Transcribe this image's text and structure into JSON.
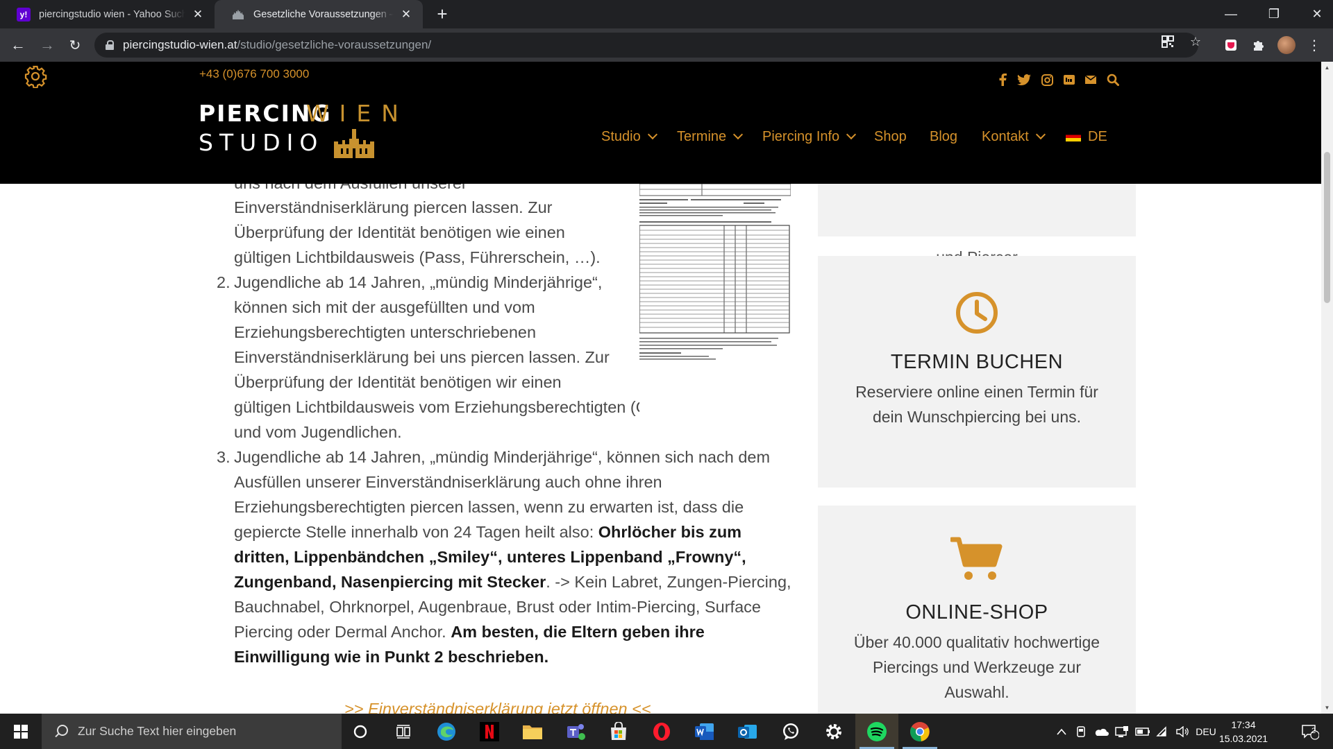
{
  "browser": {
    "tabs": [
      {
        "title": "piercingstudio wien - Yahoo Suche",
        "favicon": "yahoo-icon"
      },
      {
        "title": "Gesetzliche Voraussetzungen – Piercing Studio Wien",
        "favicon": "castle-icon"
      }
    ],
    "url_host": "piercingstudio-wien.at",
    "url_path": "/studio/gesetzliche-voraussetzungen/"
  },
  "site": {
    "phone": "+43 (0)676 700 3000",
    "logo": {
      "line1": "PIERCING",
      "line2": "STUDIO",
      "wien": "WIEN"
    },
    "nav": [
      "Studio",
      "Termine",
      "Piercing Info",
      "Shop",
      "Blog",
      "Kontakt",
      "DE"
    ],
    "accent": "#d6922b"
  },
  "content": {
    "cut_line": "uns nach dem Ausfüllen unserer",
    "item1_tail": [
      "Einverständniserklärung piercen lassen. Zur",
      "Überprüfung der Identität benötigen wie einen",
      "gültigen Lichtbildausweis (Pass, Führerschein, …)."
    ],
    "item2_num": "2.",
    "item2_lines": [
      "Jugendliche ab 14 Jahren, „mündig Minderjährige“,",
      "können sich mit der ausgefüllten und vom",
      "Erziehungsberechtigten unterschriebenen",
      "Einverständniserklärung bei uns piercen lassen. Zur",
      "Überprüfung der Identität benötigen wir einen",
      "gültigen Lichtbildausweis vom Erziehungsberechtigten (Original oder Kopie)",
      "und vom Jugendlichen."
    ],
    "item3_num": "3.",
    "item3_lines": [
      "Jugendliche ab 14 Jahren, „mündig Minderjährige“, können sich nach dem",
      "Ausfüllen unserer Einverständniserklärung auch ohne ihren",
      "Erziehungsberechtigten piercen lassen, wenn zu erwarten ist, dass die"
    ],
    "item3_l4_plain": "gepiercte Stelle innerhalb von 24 Tagen heilt also: ",
    "item3_l4_bold": "Ohrlöcher bis zum",
    "item3_l5_bold": "dritten, Lippenbändchen „Smiley“, unteres Lippenband „Frowny“,",
    "item3_l6_bold": "Zungenband, Nasenpiercing mit Stecker",
    "item3_l6_plain": ". -> Kein Labret, Zungen-Piercing,",
    "item3_l7": "Bauchnabel, Ohrknorpel, Augenbraue, Brust oder Intim-Piercing, Surface",
    "item3_l8_plain": "Piercing oder Dermal Anchor. ",
    "item3_l8_bold": "Am besten, die Eltern geben ihre",
    "item3_l9_bold": "Einwilligung wie in Punkt 2 beschrieben.",
    "link": ">> Einverständniserklärung jetzt öffnen <<"
  },
  "sidebar": {
    "w0_text": "und Piercer",
    "w1": {
      "icon": "clock-icon",
      "title": "TERMIN BUCHEN",
      "lines": [
        "Reserviere online einen Termin für",
        "dein Wunschpiercing bei uns."
      ]
    },
    "w2": {
      "icon": "cart-icon",
      "title": "ONLINE-SHOP",
      "lines": [
        "Über 40.000 qualitativ hochwertige",
        "Piercings und Werkzeuge zur",
        "Auswahl."
      ]
    }
  },
  "taskbar": {
    "search_placeholder": "Zur Suche Text hier eingeben",
    "lang": "DEU",
    "time": "17:34",
    "date": "15.03.2021",
    "notifications": "2"
  }
}
